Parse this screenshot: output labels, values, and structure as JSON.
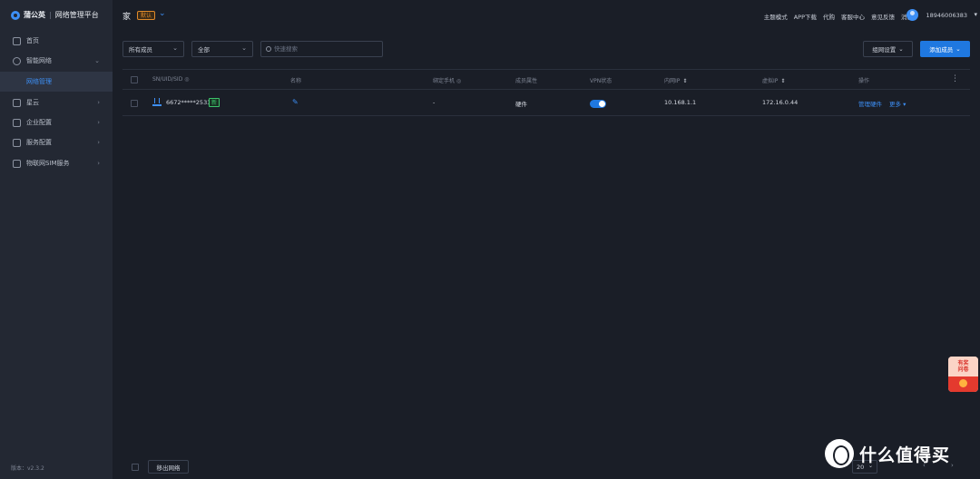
{
  "app": {
    "brand": "蒲公英",
    "separator": "|",
    "subtitle": "网络管理平台",
    "version": "版本：v2.3.2"
  },
  "sidebar": {
    "items": [
      {
        "label": "首页",
        "icon": "home-icon"
      },
      {
        "label": "智能网络",
        "icon": "network-icon",
        "expanded": true
      },
      {
        "label": "网络管理",
        "sub": true,
        "active": true
      },
      {
        "label": "星云",
        "icon": "cloud-icon"
      },
      {
        "label": "企业配置",
        "icon": "enterprise-icon"
      },
      {
        "label": "服务配置",
        "icon": "service-icon"
      },
      {
        "label": "物联网SIM服务",
        "icon": "sim-icon"
      }
    ]
  },
  "header": {
    "network_name": "家",
    "default_badge": "默认",
    "links": [
      "主题模式",
      "APP下载",
      "代购",
      "客服中心",
      "意见反馈",
      "消息"
    ],
    "phone": "18946006383"
  },
  "filters": {
    "member_filter": "所有成员",
    "type_filter": "全部",
    "search_placeholder": "快速搜索",
    "netset_label": "组网设置",
    "add_member_label": "添加成员"
  },
  "table": {
    "headers": {
      "sn": "SN/UID/SID",
      "name": "名称",
      "phone": "绑定手机",
      "attr": "成员属性",
      "vpn": "VPN状态",
      "lan_ip": "内网IP",
      "virtual_ip": "虚拟IP",
      "ops": "操作"
    },
    "rows": [
      {
        "sn": "6672*****2533",
        "new_badge": "新",
        "phone": "-",
        "attr": "硬件",
        "vpn_on": true,
        "lan_ip": "10.168.1.1",
        "virtual_ip": "172.16.0.44",
        "manage": "管理硬件",
        "more": "更多"
      }
    ]
  },
  "footer": {
    "remove_label": "移出网络",
    "page_size": "20"
  },
  "promo": {
    "line1": "有奖",
    "line2": "问卷"
  },
  "watermark": {
    "text": "什么值得买"
  },
  "colors": {
    "accent": "#1f78e0",
    "badge": "#e08a2a",
    "new": "#3cc46a"
  }
}
